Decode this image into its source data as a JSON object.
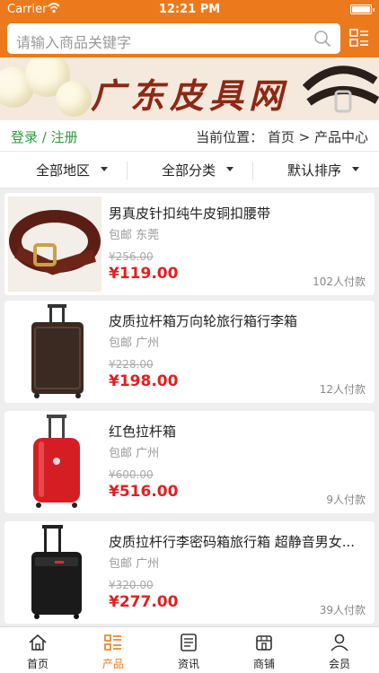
{
  "status": {
    "carrier": "Carrier",
    "time": "12:21 PM"
  },
  "search": {
    "placeholder": "请输入商品关键字"
  },
  "banner": {
    "title": "广东皮具网"
  },
  "breadcrumb": {
    "login": "登录 / 注册",
    "location": "当前位置： 首页 > 产品中心"
  },
  "filters": [
    "全部地区",
    "全部分类",
    "默认排序"
  ],
  "products": [
    {
      "name": "男真皮针扣纯牛皮铜扣腰带",
      "tags": "包邮 东莞",
      "old_price": "¥256.00",
      "price": "¥119.00",
      "sold": "102人付款",
      "image": "belt"
    },
    {
      "name": "皮质拉杆箱万向轮旅行箱行李箱",
      "tags": "包邮 广州",
      "old_price": "¥228.00",
      "price": "¥198.00",
      "sold": "12人付款",
      "image": "brown-suitcase"
    },
    {
      "name": "红色拉杆箱",
      "tags": "包邮 广州",
      "old_price": "¥600.00",
      "price": "¥516.00",
      "sold": "9人付款",
      "image": "red-suitcase"
    },
    {
      "name": "皮质拉杆行李密码箱旅行箱 超静音男女...",
      "tags": "包邮 广州",
      "old_price": "¥320.00",
      "price": "¥277.00",
      "sold": "39人付款",
      "image": "black-suitcase"
    }
  ],
  "tabs": [
    {
      "label": "首页",
      "icon": "home-icon"
    },
    {
      "label": "产品",
      "icon": "products-icon",
      "active": true
    },
    {
      "label": "资讯",
      "icon": "news-icon"
    },
    {
      "label": "商铺",
      "icon": "shop-icon"
    },
    {
      "label": "会员",
      "icon": "member-icon"
    }
  ],
  "colors": {
    "accent": "#ec7a1c",
    "price": "#e02020",
    "login": "#2f9a3a"
  }
}
